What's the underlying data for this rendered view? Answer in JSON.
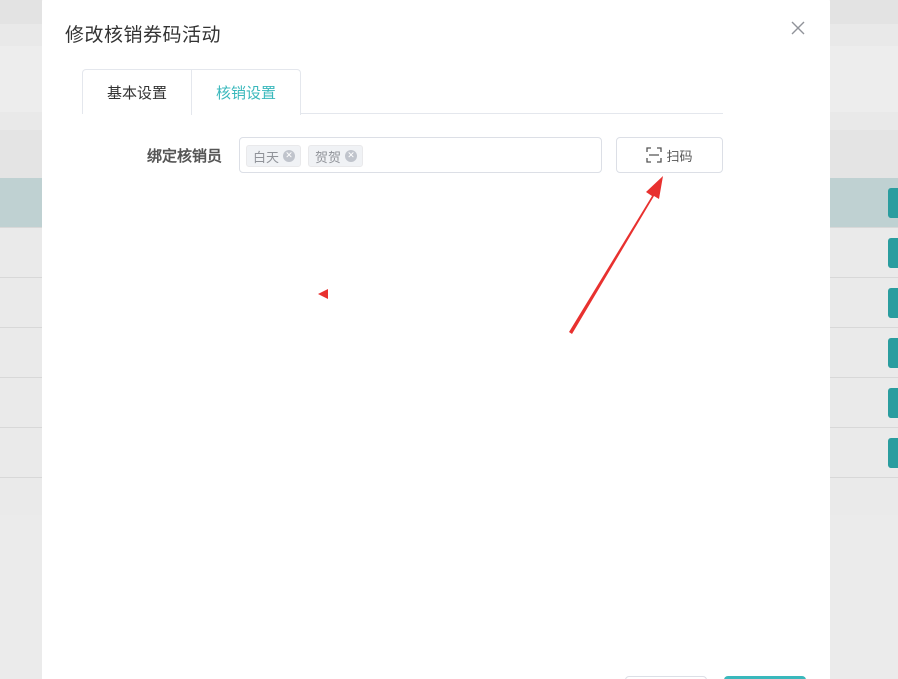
{
  "dialog": {
    "title": "修改核销券码活动",
    "close_icon": "close-icon"
  },
  "tabs": [
    {
      "label": "基本设置",
      "active": false
    },
    {
      "label": "核销设置",
      "active": true
    }
  ],
  "form": {
    "verifier_label": "绑定核销员",
    "selected_tags": [
      "白天",
      "贺贺"
    ],
    "scan_button_label": "扫码",
    "scan_icon": "scan-icon"
  },
  "colors": {
    "accent": "#3ab8bc",
    "annotation": "#e8312f"
  }
}
